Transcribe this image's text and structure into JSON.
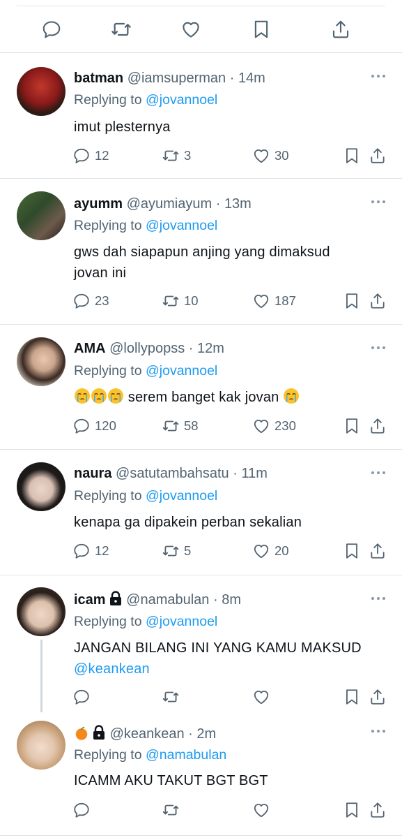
{
  "tweets": [
    {
      "name": "batman",
      "handle": "@iamsuperman",
      "time": "14m",
      "replying_to_prefix": "Replying to ",
      "replying_to": "@jovannoel",
      "text": "imut plesternya",
      "replies": "12",
      "retweets": "3",
      "likes": "30"
    },
    {
      "name": "ayumm",
      "handle": "@ayumiayum",
      "time": "13m",
      "replying_to_prefix": "Replying to ",
      "replying_to": "@jovannoel",
      "text_line1": "gws dah siapapun anjing yang dimaksud",
      "text_line2": "jovan ini",
      "replies": "23",
      "retweets": "10",
      "likes": "187"
    },
    {
      "name": "AMA",
      "handle": "@lollypopss",
      "time": "12m",
      "replying_to_prefix": "Replying to ",
      "replying_to": "@jovannoel",
      "text": " serem banget kak jovan ",
      "replies": "120",
      "retweets": "58",
      "likes": "230"
    },
    {
      "name": "naura",
      "handle": "@satutambahsatu",
      "time": "11m",
      "replying_to_prefix": "Replying to ",
      "replying_to": "@jovannoel",
      "text": "kenapa ga dipakein perban sekalian",
      "replies": "12",
      "retweets": "5",
      "likes": "20"
    },
    {
      "name": "icam",
      "handle": "@namabulan",
      "time": "8m",
      "replying_to_prefix": "Replying to ",
      "replying_to": "@jovannoel",
      "text": "JANGAN BILANG INI YANG KAMU MAKSUD",
      "text_mention": "@keankean",
      "locked": true
    },
    {
      "name_emoji": "orange-emoji",
      "handle": "@keankean",
      "time": "2m",
      "replying_to_prefix": "Replying to ",
      "replying_to": "@namabulan",
      "text": "ICAMM AKU TAKUT BGT BGT",
      "locked": true
    }
  ],
  "separator": " · ",
  "icons": [
    "reply-icon",
    "retweet-icon",
    "like-icon",
    "bookmark-icon",
    "share-icon",
    "more-icon",
    "lock-icon",
    "loudly-crying-face-emoji"
  ],
  "colors": {
    "text": "#0f1419",
    "secondary": "#536471",
    "link": "#1d9bf0",
    "divider": "#dfe3e6"
  }
}
